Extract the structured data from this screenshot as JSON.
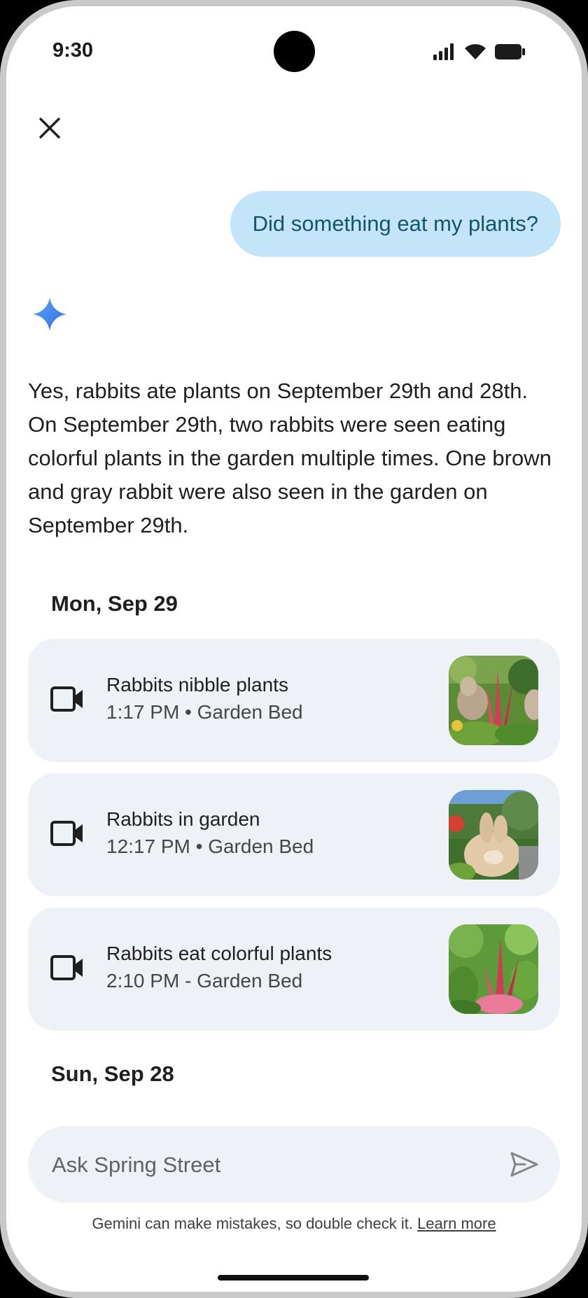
{
  "status_bar": {
    "time": "9:30"
  },
  "conversation": {
    "user_message": "Did something eat my plants?",
    "answer": "Yes, rabbits ate plants on September 29th and 28th. On September 29th, two rabbits were seen eating colorful plants in the garden multiple times. One brown and gray rabbit were also seen in the garden on September 29th."
  },
  "days": [
    {
      "heading": "Mon, Sep 29",
      "events": [
        {
          "title": "Rabbits nibble plants",
          "subtitle": "1:17 PM • Garden Bed"
        },
        {
          "title": "Rabbits in garden",
          "subtitle": "12:17 PM • Garden Bed"
        },
        {
          "title": "Rabbits eat colorful plants",
          "subtitle": "2:10 PM - Garden Bed"
        }
      ]
    },
    {
      "heading": "Sun, Sep 28"
    }
  ],
  "input": {
    "placeholder": "Ask Spring Street"
  },
  "footer": {
    "disclaimer": "Gemini can make mistakes, so double check it.",
    "learn_more": "Learn more"
  },
  "colors": {
    "user_bubble": "#c3e4f9",
    "card": "#eef2f7",
    "sparkle": "#4285f4"
  }
}
